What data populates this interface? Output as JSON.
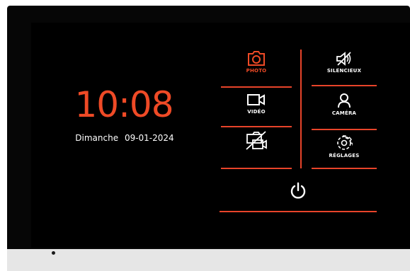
{
  "clock": {
    "time": "10:08",
    "day": "Dimanche",
    "date": "09-01-2024"
  },
  "menu": {
    "photo": {
      "label": "PHOTO",
      "icon": "camera-photo-icon",
      "active": true
    },
    "silence": {
      "label": "SILENCIEUX",
      "icon": "speaker-muted-icon"
    },
    "video": {
      "label": "VIDÉO",
      "icon": "video-camera-icon"
    },
    "camera": {
      "label": "CAMÉRA",
      "icon": "person-icon"
    },
    "no_video": {
      "label": "",
      "icon": "video-disabled-icon"
    },
    "settings": {
      "label": "RÉGLAGES",
      "icon": "gear-icon"
    },
    "power": {
      "icon": "power-icon"
    }
  },
  "colors": {
    "accent": "#ef4a26",
    "screen": "#000000",
    "text": "#ffffff"
  }
}
